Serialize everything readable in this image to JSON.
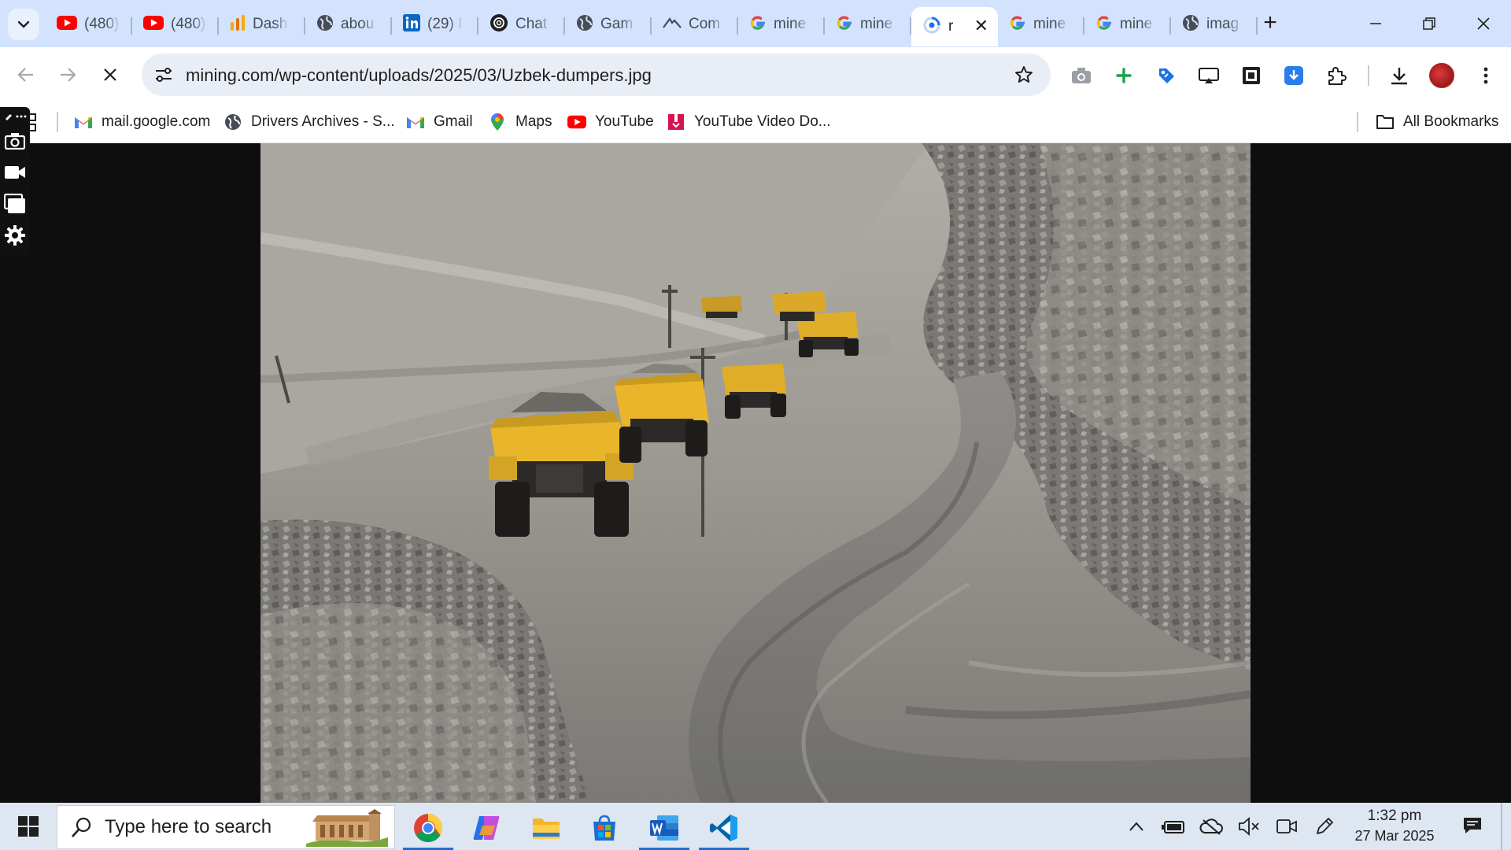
{
  "browser": {
    "tabs": [
      {
        "label": "(480)",
        "icon": "youtube-icon"
      },
      {
        "label": "(480)",
        "icon": "youtube-icon"
      },
      {
        "label": "Dash",
        "icon": "analytics-icon"
      },
      {
        "label": "abou",
        "icon": "globe-icon"
      },
      {
        "label": "(29) I",
        "icon": "linkedin-icon"
      },
      {
        "label": "Chat",
        "icon": "chatgpt-icon"
      },
      {
        "label": "Gam",
        "icon": "globe-icon"
      },
      {
        "label": "Com",
        "icon": "site-icon"
      },
      {
        "label": "mine",
        "icon": "google-icon"
      },
      {
        "label": "mine",
        "icon": "google-icon"
      },
      {
        "label": "r",
        "icon": "loading-icon",
        "active": true
      },
      {
        "label": "mine",
        "icon": "google-icon"
      },
      {
        "label": "mine",
        "icon": "google-icon"
      },
      {
        "label": "imag",
        "icon": "globe-icon"
      }
    ],
    "close_tab_glyph": "✕",
    "new_tab_glyph": "+"
  },
  "toolbar": {
    "url": "mining.com/wp-content/uploads/2025/03/Uzbek-dumpers.jpg"
  },
  "bookmarks": [
    {
      "label": "mail.google.com",
      "icon": "gmail-icon"
    },
    {
      "label": "Drivers Archives - S...",
      "icon": "globe-icon"
    },
    {
      "label": "Gmail",
      "icon": "gmail-icon"
    },
    {
      "label": "Maps",
      "icon": "maps-icon"
    },
    {
      "label": "YouTube",
      "icon": "youtube-icon"
    },
    {
      "label": "YouTube Video Do...",
      "icon": "video-downloader-icon"
    }
  ],
  "all_bookmarks_label": "All Bookmarks",
  "taskbar": {
    "search_placeholder": "Type here to search",
    "time": "1:32 pm",
    "date": "27 Mar 2025"
  },
  "colors": {
    "tab_strip": "#d3e3fd",
    "omnibox": "#e9eef6",
    "taskbar": "#dde6f1",
    "truck_yellow": "#e9b52a"
  }
}
